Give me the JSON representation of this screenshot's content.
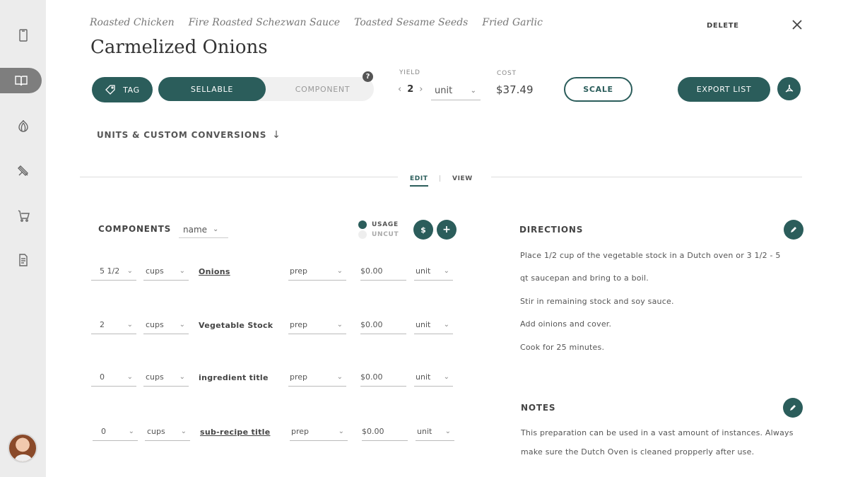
{
  "breadcrumbs": [
    "Roasted Chicken",
    "Fire Roasted Schezwan Sauce",
    "Toasted Sesame Seeds",
    "Fried Garlic"
  ],
  "title": "Carmelized Onions",
  "header": {
    "delete_label": "DELETE"
  },
  "toolbar": {
    "tag_label": "TAG",
    "sellable_label": "SELLABLE",
    "component_label": "COMPONENT",
    "help_label": "?",
    "yield_label": "YIELD",
    "yield_value": "2",
    "yield_unit": "unit",
    "cost_label": "COST",
    "cost_value": "$37.49",
    "scale_label": "SCALE",
    "export_label": "EXPORT LIST"
  },
  "units_link": "UNITS & CUSTOM CONVERSIONS",
  "tabs": {
    "edit": "EDIT",
    "separator": "|",
    "view": "VIEW"
  },
  "components": {
    "title": "COMPONENTS",
    "sort": "name",
    "legend": {
      "usage": "USAGE",
      "uncut": "UNCUT"
    },
    "cost_btn": "$",
    "add_btn": "+",
    "rows": [
      {
        "qty": "5 1/2",
        "unit": "cups",
        "name": "Onions",
        "prep": "prep",
        "price": "$0.00",
        "price_unit": "unit"
      },
      {
        "qty": "2",
        "unit": "cups",
        "name": "Vegetable Stock",
        "prep": "prep",
        "price": "$0.00",
        "price_unit": "unit"
      },
      {
        "qty": "0",
        "unit": "cups",
        "name": "ingredient title",
        "prep": "prep",
        "price": "$0.00",
        "price_unit": "unit"
      },
      {
        "qty": "0",
        "unit": "cups",
        "name": "sub-recipe title",
        "prep": "prep",
        "price": "$0.00",
        "price_unit": "unit"
      }
    ]
  },
  "directions": {
    "title": "DIRECTIONS",
    "lines": [
      "Place 1/2 cup of the vegetable stock in a Dutch oven or 3 1/2 - 5",
      "qt saucepan and bring to a boil.",
      "Stir in remaining stock and soy sauce.",
      "Add oinions and cover.",
      "Cook for 25 minutes."
    ]
  },
  "notes": {
    "title": "NOTES",
    "lines": [
      "This preparation can be used in a vast amount of instances. Always",
      "make sure the Dutch Oven is cleaned propperly after use."
    ]
  },
  "colors": {
    "accent": "#2b5d5b",
    "sidebar": "#ececec",
    "active_nav": "#7e7e7e"
  },
  "icons": {
    "sidebar": [
      "phone-icon",
      "book-icon",
      "onion-icon",
      "knife-icon",
      "cart-icon",
      "report-icon"
    ],
    "tag": "tag-icon",
    "close": "close-icon",
    "pdf": "pdf-icon",
    "edit": "pencil-icon"
  }
}
